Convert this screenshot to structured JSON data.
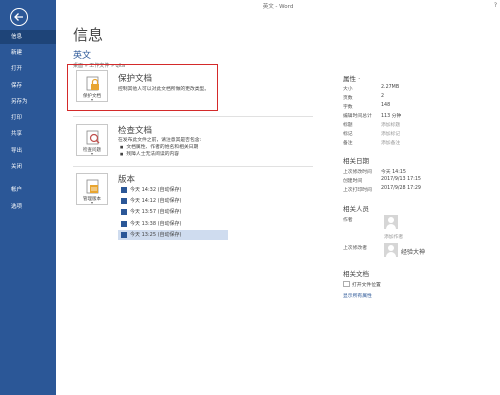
{
  "window": {
    "title": "英文 - Word",
    "help": "?"
  },
  "nav": {
    "items": [
      {
        "label": "信息",
        "active": true
      },
      {
        "label": "新建"
      },
      {
        "label": "打开"
      },
      {
        "label": "保存"
      },
      {
        "label": "另存为"
      },
      {
        "label": "打印"
      },
      {
        "label": "共享"
      },
      {
        "label": "导出"
      },
      {
        "label": "关闭"
      },
      {
        "label": "帐户"
      },
      {
        "label": "选项"
      }
    ]
  },
  "main": {
    "title": "信息",
    "doc_name": "英文",
    "breadcrumb": "桌面 » 工作文件 » qita",
    "protect": {
      "tile_label": "保护文档",
      "heading": "保护文档",
      "desc": "控制其他人可以对此文档所做的更改类型。"
    },
    "inspect": {
      "tile_label": "检查问题",
      "heading": "检查文档",
      "desc": "在发布此文件之前，请注意其是否包含:",
      "bullets": [
        "文档属性、作者的姓名和相关日期",
        "残障人士无法阅读的内容"
      ]
    },
    "versions": {
      "tile_label": "管理版本",
      "heading": "版本",
      "items": [
        {
          "label": "今天 14:32 (自动保存)"
        },
        {
          "label": "今天 14:12 (自动保存)"
        },
        {
          "label": "今天 13:57 (自动保存)"
        },
        {
          "label": "今天 13:38 (自动保存)"
        },
        {
          "label": "今天 13:25 (自动保存)",
          "selected": true
        }
      ]
    }
  },
  "properties": {
    "heading": "属性 ·",
    "rows": [
      {
        "label": "大小",
        "value": "2.27MB"
      },
      {
        "label": "页数",
        "value": "2"
      },
      {
        "label": "字数",
        "value": "148"
      },
      {
        "label": "编辑时间总计",
        "value": "113 分钟"
      },
      {
        "label": "标题",
        "value": "添加标题",
        "muted": true
      },
      {
        "label": "标记",
        "value": "添加标记",
        "muted": true
      },
      {
        "label": "备注",
        "value": "添加备注",
        "muted": true
      }
    ],
    "dates_heading": "相关日期",
    "dates": [
      {
        "label": "上次修改时间",
        "value": "今天 14:15"
      },
      {
        "label": "创建时间",
        "value": "2017/9/13 17:15"
      },
      {
        "label": "上次打印时间",
        "value": "2017/9/28 17:29"
      }
    ],
    "people_heading": "相关人员",
    "author_label": "作者",
    "add_author": "添加作者",
    "modified_by_label": "上次修改者",
    "modified_by": "经验大神",
    "docs_heading": "相关文档",
    "open_location": "打开文件位置",
    "show_all": "显示所有属性"
  }
}
